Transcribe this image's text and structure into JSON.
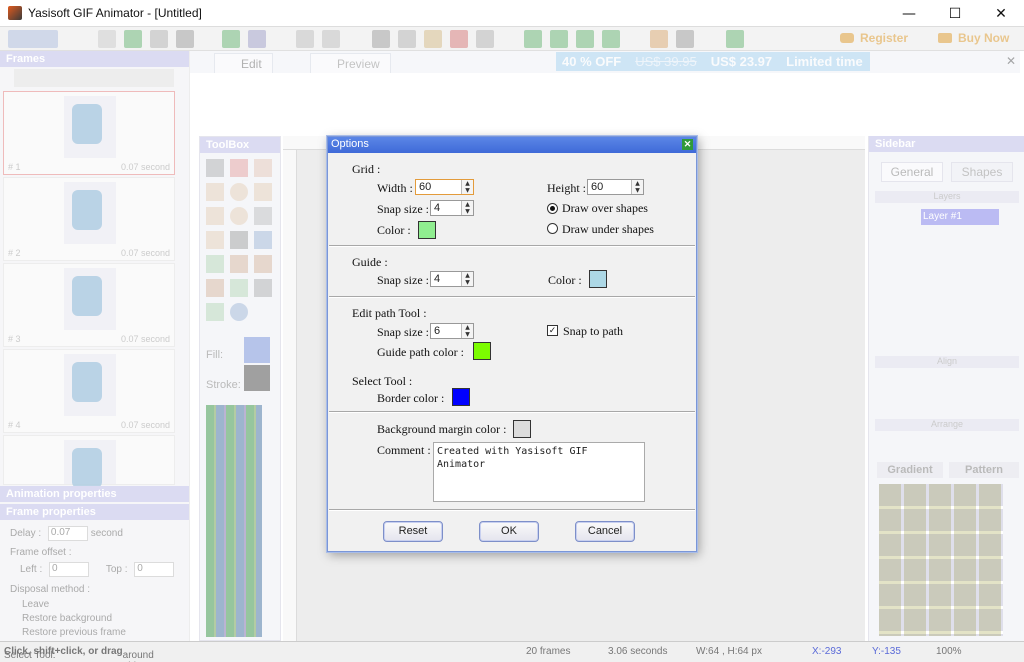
{
  "window": {
    "title": "Yasisoft GIF Animator - [Untitled]",
    "minimize": "—",
    "maximize": "☐",
    "close": "✕"
  },
  "toolbar": {
    "register_label": "Register",
    "buynow_label": "Buy Now"
  },
  "tabs": {
    "edit": "Edit",
    "preview": "Preview"
  },
  "promo": {
    "discount": "40 % OFF",
    "old_price": "US$ 39.95",
    "new_price": "US$ 23.97",
    "note": "Limited time"
  },
  "frames_panel": {
    "title": "Frames",
    "frames": [
      {
        "number": "# 1",
        "duration": "0.07 second"
      },
      {
        "number": "# 2",
        "duration": "0.07 second"
      },
      {
        "number": "# 3",
        "duration": "0.07 second"
      },
      {
        "number": "# 4",
        "duration": "0.07 second"
      }
    ],
    "animation_properties": "Animation properties",
    "frame_properties": "Frame properties",
    "delay_label": "Delay :",
    "delay_value": "0.07",
    "delay_unit": "second",
    "frame_offset_label": "Frame offset :",
    "left_label": "Left :",
    "left_value": "0",
    "top_label": "Top :",
    "top_value": "0",
    "disposal_label": "Disposal method :",
    "disposal_options": [
      "Leave",
      "Restore background",
      "Restore previous frame"
    ]
  },
  "toolbox": {
    "title": "ToolBox",
    "fill_label": "Fill:",
    "stroke_label": "Stroke:"
  },
  "sidebar": {
    "title": "Sidebar",
    "tab_general": "General",
    "tab_shapes": "Shapes",
    "layers_label": "Layers",
    "layer_name": "Layer #1",
    "align_label": "Align",
    "arrange_label": "Arrange",
    "gradient_tab": "Gradient",
    "pattern_tab": "Pattern"
  },
  "dialog": {
    "title": "Options",
    "grid": {
      "section": "Grid :",
      "width_label": "Width :",
      "width_value": "60",
      "height_label": "Height :",
      "height_value": "60",
      "snap_label": "Snap size :",
      "snap_value": "4",
      "color_label": "Color :",
      "color": "#90ee90",
      "draw_over": "Draw over shapes",
      "draw_under": "Draw under shapes"
    },
    "guide": {
      "section": "Guide :",
      "snap_label": "Snap size :",
      "snap_value": "4",
      "color_label": "Color :",
      "color": "#add8e6"
    },
    "edit_path": {
      "section": "Edit path Tool :",
      "snap_label": "Snap size :",
      "snap_value": "6",
      "snap_to_path": "Snap to path",
      "guide_color_label": "Guide path color :",
      "guide_color": "#7cfc00"
    },
    "select_tool": {
      "section": "Select Tool :",
      "border_label": "Border color :",
      "border_color": "#0000ff"
    },
    "background_margin_label": "Background margin color :",
    "background_margin_color": "#dcdcdc",
    "comment_label": "Comment :",
    "comment_value": "Created with Yasisoft GIF Animator",
    "reset_button": "Reset",
    "ok_button": "OK",
    "cancel_button": "Cancel"
  },
  "status": {
    "hint_prefix": "Select Tool:",
    "hint_bold": "Click, shift+click, or drag",
    "hint_suffix": "around objects to select.",
    "frames": "20 frames",
    "duration": "3.06 seconds",
    "size": "W:64 , H:64 px",
    "x": "X:-293",
    "y": "Y:-135",
    "zoom": "100%"
  },
  "colors": {
    "accent": "#3f6ad8",
    "panel_head": "#b9b9e6",
    "promo": "#a7d4f2"
  }
}
